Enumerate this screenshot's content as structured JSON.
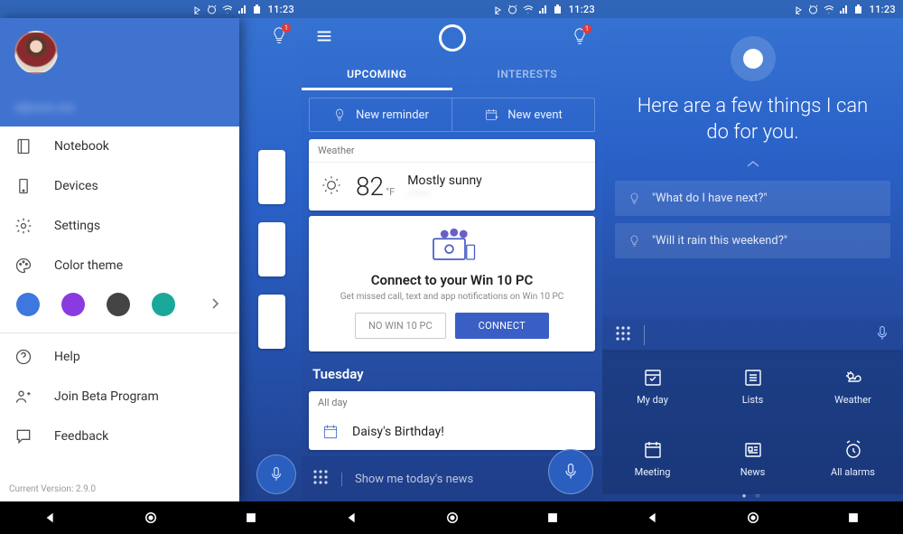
{
  "status": {
    "time": "11:23"
  },
  "drawer": {
    "items": [
      {
        "label": "Notebook"
      },
      {
        "label": "Devices"
      },
      {
        "label": "Settings"
      },
      {
        "label": "Color theme"
      }
    ],
    "colors": [
      "#3e78df",
      "#8a3be0",
      "#444444",
      "#1aa89a"
    ],
    "footer": [
      {
        "label": "Help"
      },
      {
        "label": "Join Beta Program"
      },
      {
        "label": "Feedback"
      }
    ],
    "version": "Current Version: 2.9.0"
  },
  "tip_badge": "1",
  "screen2": {
    "tabs": {
      "upcoming": "UPCOMING",
      "interests": "INTERESTS"
    },
    "quick": {
      "reminder": "New reminder",
      "event": "New event"
    },
    "weather": {
      "label": "Weather",
      "temp": "82",
      "unit": "°F",
      "cond": "Mostly sunny",
      "loc": "———"
    },
    "connect": {
      "title": "Connect to your Win 10 PC",
      "sub": "Get missed call, text and app notifications on Win 10 PC",
      "no": "NO WIN 10 PC",
      "yes": "CONNECT"
    },
    "day": "Tuesday",
    "event": {
      "allday": "All day",
      "title": "Daisy's Birthday!"
    },
    "hint": "Show me today's news"
  },
  "screen3": {
    "greeting": "Here are a few things I can do for you.",
    "suggestions": [
      "\"What do I have next?\"",
      "\"Will it rain this weekend?\""
    ],
    "tiles": [
      {
        "label": "My day"
      },
      {
        "label": "Lists"
      },
      {
        "label": "Weather"
      },
      {
        "label": "Meeting"
      },
      {
        "label": "News"
      },
      {
        "label": "All alarms"
      }
    ]
  }
}
